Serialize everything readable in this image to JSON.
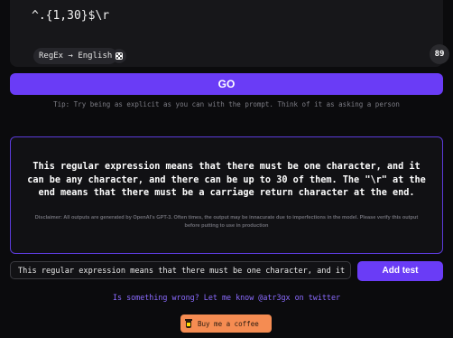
{
  "regex": {
    "pattern": "^.{1,30}$\\r",
    "mode_label": "RegEx → English",
    "char_count": "89"
  },
  "actions": {
    "go_label": "GO",
    "add_test_label": "Add test"
  },
  "tip": "Tip: Try being as explicit as you can with the prompt. Think of it as asking a person",
  "output": {
    "explanation": "This regular expression means that there must be one character, and it can be any character, and there can be up to 30 of them. The \"\\r\" at the end means that there must be a carriage return character at the end.",
    "disclaimer": "Disclaimer: All outputs are generated by OpenAI's GPT-3. Often times, the output may be innacurate due to imperfections in the model. Please verify this output before putting to use in production"
  },
  "test": {
    "value": "This regular expression means that there must be one character, and it can"
  },
  "footer": {
    "feedback_text": "Is something wrong? Let me know @atr3gx on twitter",
    "coffee_label": "Buy me a coffee"
  },
  "colors": {
    "accent": "#6a3cf6",
    "coffee": "#f58c52"
  },
  "icons": {
    "dice": "dice-icon",
    "coffee": "coffee-cup-icon"
  }
}
